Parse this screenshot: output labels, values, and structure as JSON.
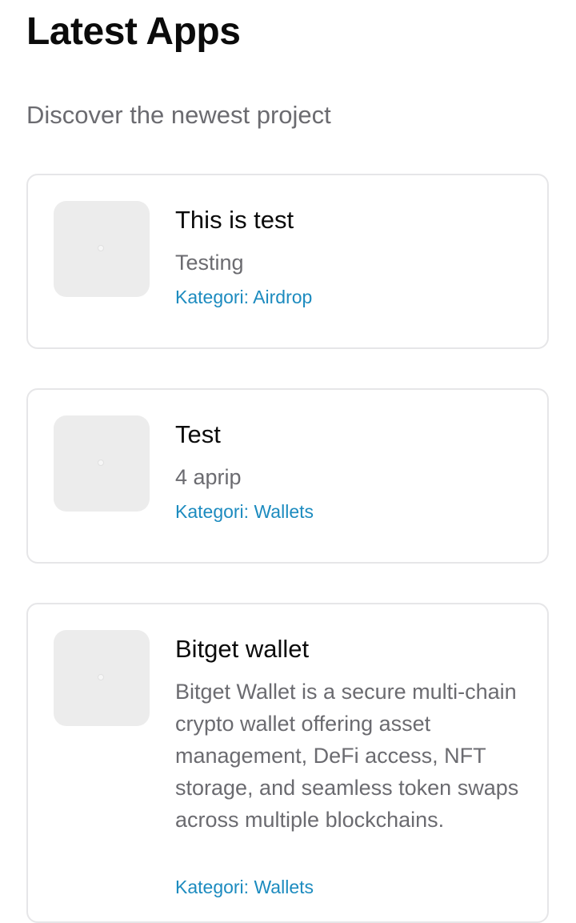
{
  "header": {
    "title": "Latest Apps",
    "subtitle": "Discover the newest project"
  },
  "apps": [
    {
      "name": "This is test",
      "description": "Testing",
      "category": "Kategori: Airdrop",
      "thumbnail_icon": "image-placeholder-icon"
    },
    {
      "name": "Test",
      "description": "4 aprip",
      "category": "Kategori: Wallets",
      "thumbnail_icon": "image-placeholder-icon"
    },
    {
      "name": "Bitget wallet",
      "description": "Bitget Wallet is a secure multi-chain crypto wallet offering asset management, DeFi access, NFT storage, and seamless token swaps across multiple blockchains.",
      "category": "Kategori: Wallets",
      "thumbnail_icon": "image-placeholder-icon"
    }
  ],
  "colors": {
    "title": "#0b0b0b",
    "muted_text": "#6b6b70",
    "category_link": "#1c8bbf",
    "card_border": "#e6e6e8",
    "thumbnail_bg": "#ececec"
  }
}
